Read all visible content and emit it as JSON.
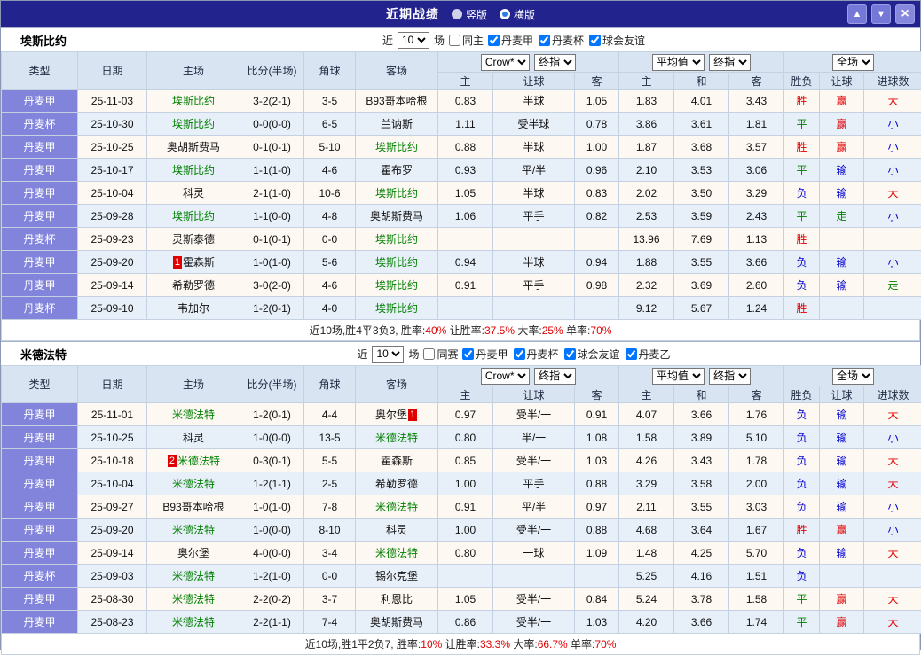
{
  "titlebar": {
    "title": "近期战绩",
    "vertical_label": "竖版",
    "horizontal_label": "横版",
    "selected_layout": "横版",
    "up_icon": "▲",
    "down_icon": "▼",
    "close_icon": "×"
  },
  "controls": {
    "odds_source": "Crow*",
    "odds_stage": "终指",
    "avg_source": "平均值",
    "avg_stage": "终指",
    "scope": "全场"
  },
  "table_header": {
    "main": [
      "类型",
      "日期",
      "主场",
      "比分(半场)",
      "角球",
      "客场"
    ],
    "sub": [
      "主",
      "让球",
      "客",
      "主",
      "和",
      "客",
      "胜负",
      "让球",
      "进球数"
    ]
  },
  "colors": {
    "titlebar_bg": "#23238e",
    "button_bg": "#7678d8",
    "league_cell_bg": "#8184da",
    "header_bg": "#d9e4f2",
    "row_odd": "#fdf8f2",
    "row_even": "#e7eff9",
    "border": "#c3d1e1",
    "red": "#e10000",
    "green": "#008000",
    "blue": "#0000d0",
    "team_green": "#008000",
    "summary_red": "#e10000"
  },
  "value_colors": {
    "胜": "#e10000",
    "平": "#008000",
    "负": "#0000d0",
    "赢": "#e10000",
    "输": "#0000d0",
    "走": "#008000",
    "大": "#e10000",
    "小": "#0000d0"
  },
  "sections": [
    {
      "team": "埃斯比约",
      "filter": {
        "near_label": "近",
        "count": "10",
        "games_label": "场",
        "same_label": "同主",
        "same_checked": false,
        "leagues": [
          {
            "label": "丹麦甲",
            "checked": true
          },
          {
            "label": "丹麦杯",
            "checked": true
          },
          {
            "label": "球会友谊",
            "checked": true
          }
        ]
      },
      "rows": [
        {
          "league": "丹麦甲",
          "date": "25-11-03",
          "home": {
            "name": "埃斯比约",
            "green": true
          },
          "score": "3-2(2-1)",
          "corner": "3-5",
          "away": {
            "name": "B93哥本哈根"
          },
          "odds": [
            "0.83",
            "半球",
            "1.05"
          ],
          "avg": [
            "1.83",
            "4.01",
            "3.43"
          ],
          "result": "胜",
          "handicap_result": "赢",
          "goals_result": "大"
        },
        {
          "league": "丹麦杯",
          "date": "25-10-30",
          "home": {
            "name": "埃斯比约",
            "green": true
          },
          "score": "0-0(0-0)",
          "corner": "6-5",
          "away": {
            "name": "兰讷斯"
          },
          "odds": [
            "1.11",
            "受半球",
            "0.78"
          ],
          "avg": [
            "3.86",
            "3.61",
            "1.81"
          ],
          "result": "平",
          "handicap_result": "赢",
          "goals_result": "小"
        },
        {
          "league": "丹麦甲",
          "date": "25-10-25",
          "home": {
            "name": "奥胡斯费马"
          },
          "score": "0-1(0-1)",
          "corner": "5-10",
          "away": {
            "name": "埃斯比约",
            "green": true
          },
          "odds": [
            "0.88",
            "半球",
            "1.00"
          ],
          "avg": [
            "1.87",
            "3.68",
            "3.57"
          ],
          "result": "胜",
          "handicap_result": "赢",
          "goals_result": "小"
        },
        {
          "league": "丹麦甲",
          "date": "25-10-17",
          "home": {
            "name": "埃斯比约",
            "green": true
          },
          "score": "1-1(1-0)",
          "corner": "4-6",
          "away": {
            "name": "霍布罗"
          },
          "odds": [
            "0.93",
            "平/半",
            "0.96"
          ],
          "avg": [
            "2.10",
            "3.53",
            "3.06"
          ],
          "result": "平",
          "handicap_result": "输",
          "goals_result": "小"
        },
        {
          "league": "丹麦甲",
          "date": "25-10-04",
          "home": {
            "name": "科灵"
          },
          "score": "2-1(1-0)",
          "corner": "10-6",
          "away": {
            "name": "埃斯比约",
            "green": true
          },
          "odds": [
            "1.05",
            "半球",
            "0.83"
          ],
          "avg": [
            "2.02",
            "3.50",
            "3.29"
          ],
          "result": "负",
          "handicap_result": "输",
          "goals_result": "大"
        },
        {
          "league": "丹麦甲",
          "date": "25-09-28",
          "home": {
            "name": "埃斯比约",
            "green": true
          },
          "score": "1-1(0-0)",
          "corner": "4-8",
          "away": {
            "name": "奥胡斯费马"
          },
          "odds": [
            "1.06",
            "平手",
            "0.82"
          ],
          "avg": [
            "2.53",
            "3.59",
            "2.43"
          ],
          "result": "平",
          "handicap_result": "走",
          "goals_result": "小"
        },
        {
          "league": "丹麦杯",
          "date": "25-09-23",
          "home": {
            "name": "灵斯泰德"
          },
          "score": "0-1(0-1)",
          "corner": "0-0",
          "away": {
            "name": "埃斯比约",
            "green": true
          },
          "odds": [
            "",
            "",
            ""
          ],
          "avg": [
            "13.96",
            "7.69",
            "1.13"
          ],
          "result": "胜",
          "handicap_result": "",
          "goals_result": ""
        },
        {
          "league": "丹麦甲",
          "date": "25-09-20",
          "home": {
            "name": "霍森斯",
            "badge": "1",
            "badge_pos": "before"
          },
          "score": "1-0(1-0)",
          "corner": "5-6",
          "away": {
            "name": "埃斯比约",
            "green": true
          },
          "odds": [
            "0.94",
            "半球",
            "0.94"
          ],
          "avg": [
            "1.88",
            "3.55",
            "3.66"
          ],
          "result": "负",
          "handicap_result": "输",
          "goals_result": "小"
        },
        {
          "league": "丹麦甲",
          "date": "25-09-14",
          "home": {
            "name": "希勒罗德"
          },
          "score": "3-0(2-0)",
          "corner": "4-6",
          "away": {
            "name": "埃斯比约",
            "green": true
          },
          "odds": [
            "0.91",
            "平手",
            "0.98"
          ],
          "avg": [
            "2.32",
            "3.69",
            "2.60"
          ],
          "result": "负",
          "handicap_result": "输",
          "goals_result": "走"
        },
        {
          "league": "丹麦杯",
          "date": "25-09-10",
          "home": {
            "name": "韦加尔"
          },
          "score": "1-2(0-1)",
          "corner": "4-0",
          "away": {
            "name": "埃斯比约",
            "green": true
          },
          "odds": [
            "",
            "",
            ""
          ],
          "avg": [
            "9.12",
            "5.67",
            "1.24"
          ],
          "result": "胜",
          "handicap_result": "",
          "goals_result": ""
        }
      ],
      "footer": {
        "segments": [
          {
            "text": "近10场,胜4平3负3, 胜率:",
            "red": false
          },
          {
            "text": "40%",
            "red": true
          },
          {
            "text": " 让胜率:",
            "red": false
          },
          {
            "text": "37.5%",
            "red": true
          },
          {
            "text": " 大率:",
            "red": false
          },
          {
            "text": "25%",
            "red": true
          },
          {
            "text": " 单率:",
            "red": false
          },
          {
            "text": "70%",
            "red": true
          }
        ]
      }
    },
    {
      "team": "米德法特",
      "filter": {
        "near_label": "近",
        "count": "10",
        "games_label": "场",
        "same_label": "同赛",
        "same_checked": false,
        "leagues": [
          {
            "label": "丹麦甲",
            "checked": true
          },
          {
            "label": "丹麦杯",
            "checked": true
          },
          {
            "label": "球会友谊",
            "checked": true
          },
          {
            "label": "丹麦乙",
            "checked": true
          }
        ]
      },
      "rows": [
        {
          "league": "丹麦甲",
          "date": "25-11-01",
          "home": {
            "name": "米德法特",
            "green": true
          },
          "score": "1-2(0-1)",
          "corner": "4-4",
          "away": {
            "name": "奥尔堡",
            "badge": "1",
            "badge_pos": "after"
          },
          "odds": [
            "0.97",
            "受半/一",
            "0.91"
          ],
          "avg": [
            "4.07",
            "3.66",
            "1.76"
          ],
          "result": "负",
          "handicap_result": "输",
          "goals_result": "大"
        },
        {
          "league": "丹麦甲",
          "date": "25-10-25",
          "home": {
            "name": "科灵"
          },
          "score": "1-0(0-0)",
          "corner": "13-5",
          "away": {
            "name": "米德法特",
            "green": true
          },
          "odds": [
            "0.80",
            "半/一",
            "1.08"
          ],
          "avg": [
            "1.58",
            "3.89",
            "5.10"
          ],
          "result": "负",
          "handicap_result": "输",
          "goals_result": "小"
        },
        {
          "league": "丹麦甲",
          "date": "25-10-18",
          "home": {
            "name": "米德法特",
            "green": true,
            "badge": "2",
            "badge_pos": "before"
          },
          "score": "0-3(0-1)",
          "corner": "5-5",
          "away": {
            "name": "霍森斯"
          },
          "odds": [
            "0.85",
            "受半/一",
            "1.03"
          ],
          "avg": [
            "4.26",
            "3.43",
            "1.78"
          ],
          "result": "负",
          "handicap_result": "输",
          "goals_result": "大"
        },
        {
          "league": "丹麦甲",
          "date": "25-10-04",
          "home": {
            "name": "米德法特",
            "green": true
          },
          "score": "1-2(1-1)",
          "corner": "2-5",
          "away": {
            "name": "希勒罗德"
          },
          "odds": [
            "1.00",
            "平手",
            "0.88"
          ],
          "avg": [
            "3.29",
            "3.58",
            "2.00"
          ],
          "result": "负",
          "handicap_result": "输",
          "goals_result": "大"
        },
        {
          "league": "丹麦甲",
          "date": "25-09-27",
          "home": {
            "name": "B93哥本哈根"
          },
          "score": "1-0(1-0)",
          "corner": "7-8",
          "away": {
            "name": "米德法特",
            "green": true
          },
          "odds": [
            "0.91",
            "平/半",
            "0.97"
          ],
          "avg": [
            "2.11",
            "3.55",
            "3.03"
          ],
          "result": "负",
          "handicap_result": "输",
          "goals_result": "小"
        },
        {
          "league": "丹麦甲",
          "date": "25-09-20",
          "home": {
            "name": "米德法特",
            "green": true
          },
          "score": "1-0(0-0)",
          "corner": "8-10",
          "away": {
            "name": "科灵"
          },
          "odds": [
            "1.00",
            "受半/一",
            "0.88"
          ],
          "avg": [
            "4.68",
            "3.64",
            "1.67"
          ],
          "result": "胜",
          "handicap_result": "赢",
          "goals_result": "小"
        },
        {
          "league": "丹麦甲",
          "date": "25-09-14",
          "home": {
            "name": "奥尔堡"
          },
          "score": "4-0(0-0)",
          "corner": "3-4",
          "away": {
            "name": "米德法特",
            "green": true
          },
          "odds": [
            "0.80",
            "一球",
            "1.09"
          ],
          "avg": [
            "1.48",
            "4.25",
            "5.70"
          ],
          "result": "负",
          "handicap_result": "输",
          "goals_result": "大"
        },
        {
          "league": "丹麦杯",
          "date": "25-09-03",
          "home": {
            "name": "米德法特",
            "green": true
          },
          "score": "1-2(1-0)",
          "corner": "0-0",
          "away": {
            "name": "锡尔克堡"
          },
          "odds": [
            "",
            "",
            ""
          ],
          "avg": [
            "5.25",
            "4.16",
            "1.51"
          ],
          "result": "负",
          "handicap_result": "",
          "goals_result": ""
        },
        {
          "league": "丹麦甲",
          "date": "25-08-30",
          "home": {
            "name": "米德法特",
            "green": true
          },
          "score": "2-2(0-2)",
          "corner": "3-7",
          "away": {
            "name": "利恩比"
          },
          "odds": [
            "1.05",
            "受半/一",
            "0.84"
          ],
          "avg": [
            "5.24",
            "3.78",
            "1.58"
          ],
          "result": "平",
          "handicap_result": "赢",
          "goals_result": "大"
        },
        {
          "league": "丹麦甲",
          "date": "25-08-23",
          "home": {
            "name": "米德法特",
            "green": true
          },
          "score": "2-2(1-1)",
          "corner": "7-4",
          "away": {
            "name": "奥胡斯费马"
          },
          "odds": [
            "0.86",
            "受半/一",
            "1.03"
          ],
          "avg": [
            "4.20",
            "3.66",
            "1.74"
          ],
          "result": "平",
          "handicap_result": "赢",
          "goals_result": "大"
        }
      ],
      "footer": {
        "segments": [
          {
            "text": "近10场,胜1平2负7, 胜率:",
            "red": false
          },
          {
            "text": "10%",
            "red": true
          },
          {
            "text": " 让胜率:",
            "red": false
          },
          {
            "text": "33.3%",
            "red": true
          },
          {
            "text": " 大率:",
            "red": false
          },
          {
            "text": "66.7%",
            "red": true
          },
          {
            "text": " 单率:",
            "red": false
          },
          {
            "text": "70%",
            "red": true
          }
        ]
      }
    }
  ]
}
